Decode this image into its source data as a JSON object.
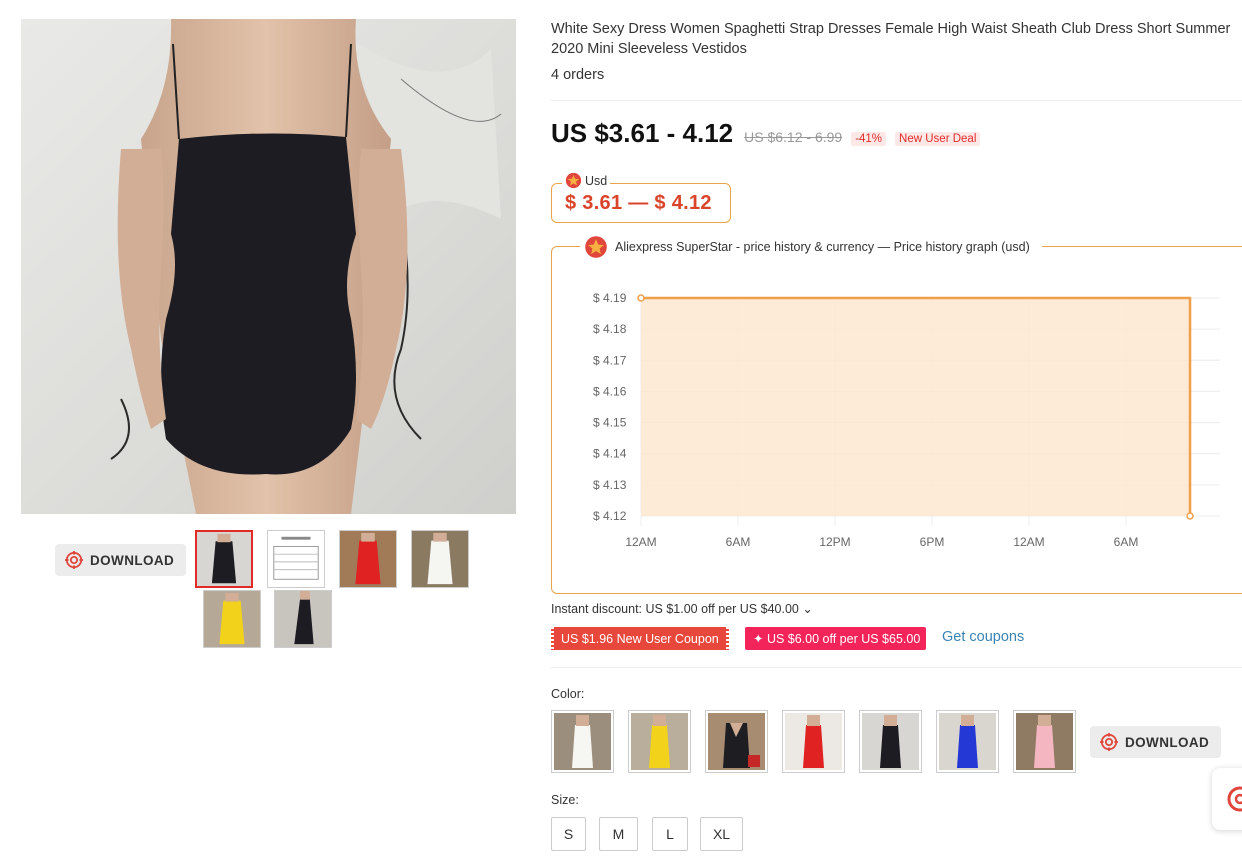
{
  "product": {
    "title": "White Sexy Dress Women Spaghetti Strap Dresses Female High Waist Sheath Club Dress Short Summer 2020 Mini Sleeveless Vestidos",
    "orders": "4 orders"
  },
  "price": {
    "current": "US $3.61 - 4.12",
    "original": "US $6.12 - 6.99",
    "discount": "-41%",
    "deal": "New User Deal"
  },
  "currency_widget": {
    "legend": "Usd",
    "value": "$ 3.61 — $ 4.12"
  },
  "price_history": {
    "legend": "Aliexpress SuperStar - price history & currency — Price history graph (usd)"
  },
  "chart_data": {
    "type": "area",
    "title": "",
    "xlabel": "",
    "ylabel": "",
    "y_ticks": [
      "$ 4.19",
      "$ 4.18",
      "$ 4.17",
      "$ 4.16",
      "$ 4.15",
      "$ 4.14",
      "$ 4.13",
      "$ 4.12"
    ],
    "x_ticks": [
      "12AM",
      "6AM",
      "12PM",
      "6PM",
      "12AM",
      "6AM"
    ],
    "ylim": [
      4.12,
      4.19
    ],
    "grid": true,
    "color": "#f0a04b",
    "fill": "#fde7d0",
    "series": [
      {
        "x": [
          0,
          1,
          2,
          3,
          4,
          5,
          5.66,
          5.66
        ],
        "y": [
          4.19,
          4.19,
          4.19,
          4.19,
          4.19,
          4.19,
          4.19,
          4.12
        ]
      }
    ]
  },
  "instant_discount": "Instant discount: US $1.00 off per US $40.00 ⌄",
  "coupons": {
    "new_user": "US $1.96 New User Coupon",
    "store": "✦ US $6.00 off per US $65.00",
    "get": "Get coupons"
  },
  "color_label": "Color:",
  "colors": [
    "white",
    "yellow",
    "black-v",
    "red",
    "black",
    "blue",
    "pink"
  ],
  "size_label": "Size:",
  "sizes": [
    "S",
    "M",
    "L",
    "XL"
  ],
  "download_label": "DOWNLOAD",
  "thumbnails": [
    "black",
    "size-chart",
    "red",
    "white",
    "yellow",
    "black-side"
  ],
  "accent": "#e02b27"
}
